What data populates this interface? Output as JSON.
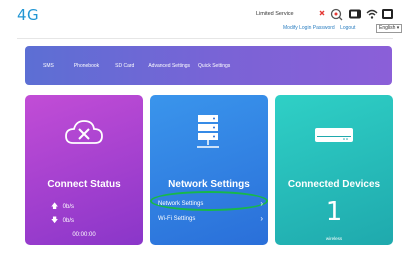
{
  "header": {
    "brand": "4G",
    "service_status": "Limited Service",
    "links": [
      "Modify Login Password",
      "Logout"
    ],
    "language": "English",
    "icons": [
      "signal-error-icon",
      "lock-icon",
      "battery-icon",
      "wifi-icon",
      "sim-icon"
    ],
    "colors": {
      "brand": "#2196d4",
      "link": "#2d7fc1",
      "error": "#e53935"
    }
  },
  "nav": {
    "tabs": [
      "SMS",
      "Phonebook",
      "SD Card",
      "Advanced Settings",
      "Quick Settings"
    ]
  },
  "cards": {
    "connect": {
      "title": "Connect Status",
      "icon": "cloud-disconnected-icon",
      "upload": "0b/s",
      "download": "0b/s",
      "duration": "00:00:00"
    },
    "network": {
      "title": "Network Settings",
      "icon": "server-icon",
      "links": [
        "Network Settings",
        "Wi-Fi Settings"
      ],
      "highlight_color": "#17b84a"
    },
    "devices": {
      "title": "Connected Devices",
      "icon": "router-device-icon",
      "count": "1",
      "label": "wireless"
    }
  }
}
